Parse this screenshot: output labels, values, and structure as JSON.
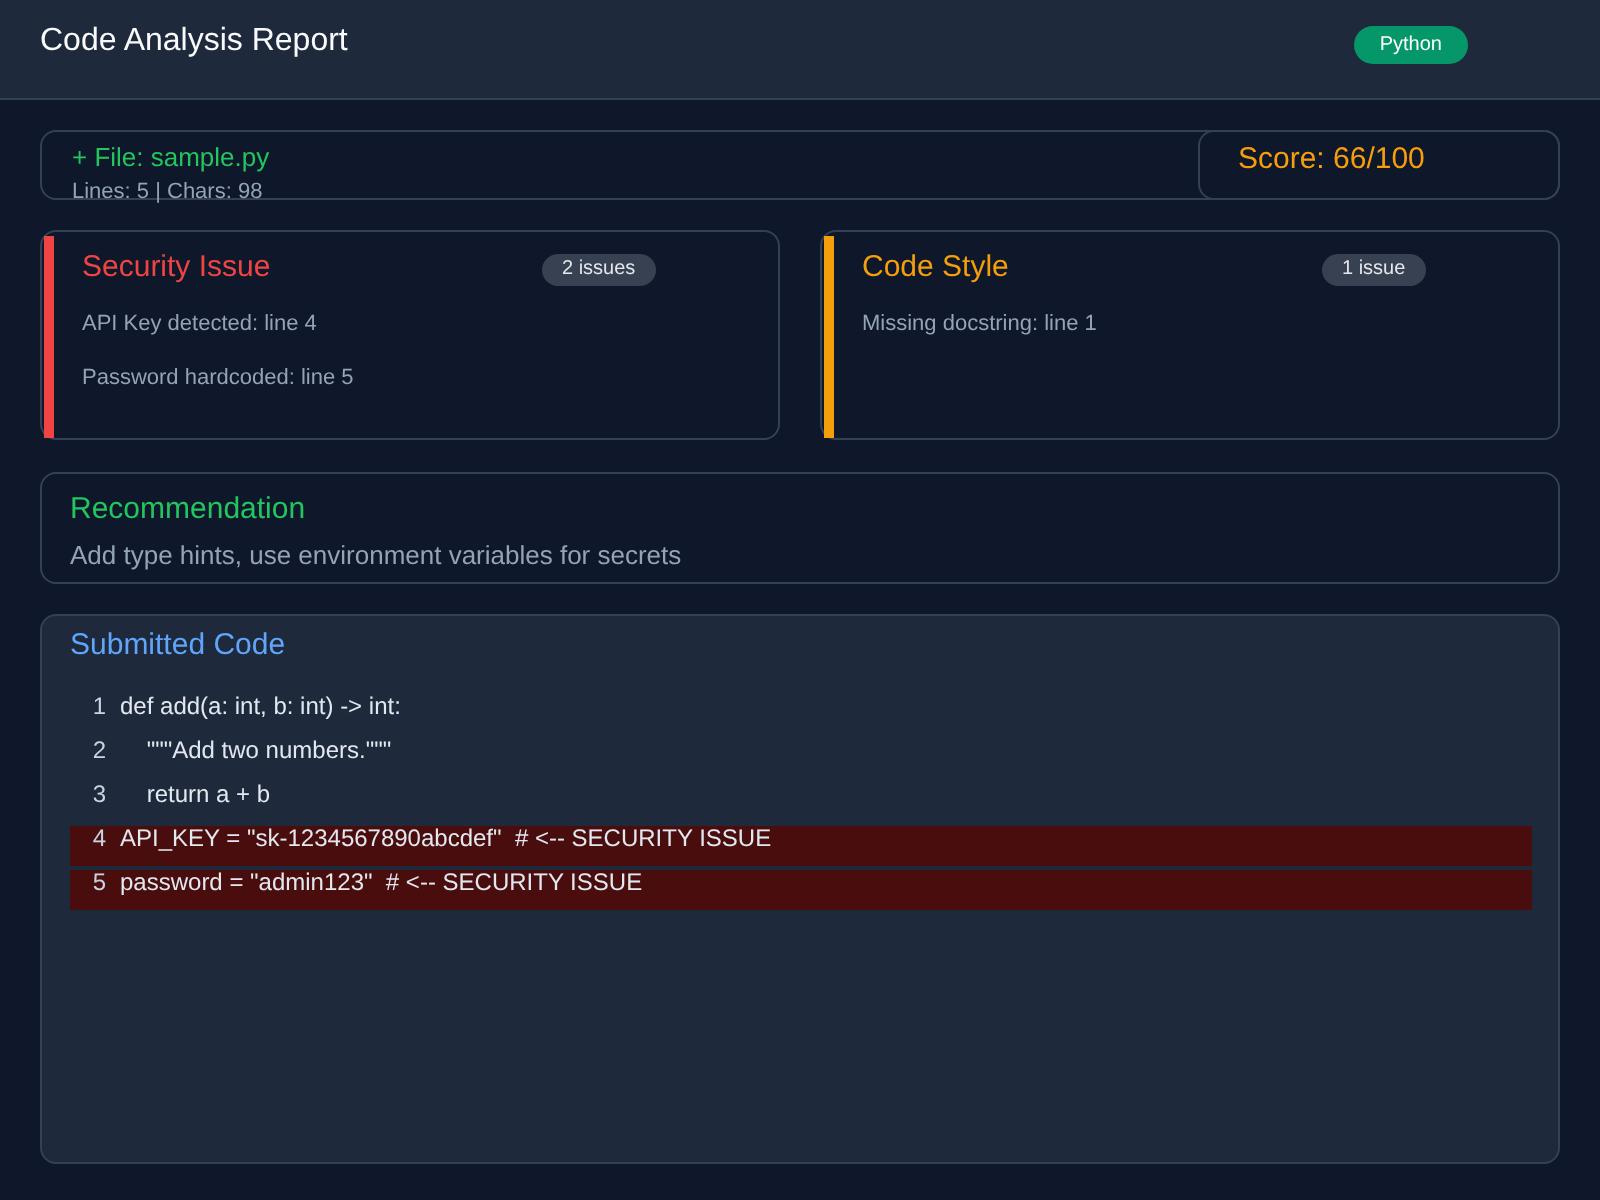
{
  "header": {
    "title": "Code Analysis Report",
    "language": "Python"
  },
  "file_summary": {
    "file": "+ File: sample.py",
    "stats": "Lines: 5 | Chars: 98",
    "score": "Score: 66/100"
  },
  "issue_groups": [
    {
      "title": "Security Issue",
      "count": "2 issues",
      "color": "#ef4444",
      "items": [
        "API Key detected: line 4",
        "Password hardcoded: line 5"
      ]
    },
    {
      "title": "Code Style",
      "count": "1 issue",
      "color": "#f59e0b",
      "items": [
        "Missing docstring: line 1"
      ]
    }
  ],
  "recommendation": {
    "title": "Recommendation",
    "text": "Add type hints, use environment variables for secrets"
  },
  "code": {
    "title": "Submitted Code",
    "lines": [
      {
        "number": "1",
        "text": "def add(a: int, b: int) -> int:",
        "flagged": false
      },
      {
        "number": "2",
        "text": "    \"\"\"Add two numbers.\"\"\"",
        "flagged": false
      },
      {
        "number": "3",
        "text": "    return a + b",
        "flagged": false
      },
      {
        "number": "4",
        "text": "API_KEY = \"sk-1234567890abcdef\"  # <-- SECURITY ISSUE",
        "flagged": true
      },
      {
        "number": "5",
        "text": "password = \"admin123\"  # <-- SECURITY ISSUE",
        "flagged": true
      }
    ]
  }
}
